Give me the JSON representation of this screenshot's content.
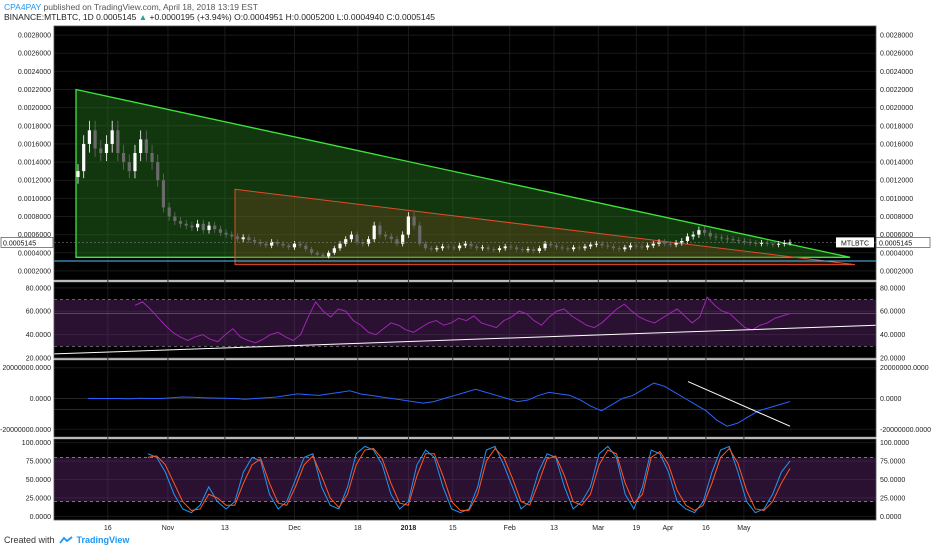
{
  "header": {
    "author": "CPA4PAY",
    "published_text": "published on TradingView.com, April 18, 2018 13:19 EST",
    "symbol": "BINANCE:MTLBTC, 1D",
    "last": "0.0005145",
    "change_arrow": "▲",
    "change": "+0.0000195 (+3.94%)",
    "open_label": "O:",
    "open": "0.0004951",
    "high_label": "H:",
    "high": "0.0005200",
    "low_label": "L:",
    "low": "0.0004940",
    "close_label": "C:",
    "close": "0.0005145"
  },
  "colors": {
    "background": "#000000",
    "grid": "#1a1a1a",
    "pane_border": "#555555",
    "axis_text": "#1e1e1e",
    "candle_up": "#ffffff",
    "candle_down": "#6a6a6a",
    "triangle_green": "#3ce63c",
    "triangle_fill": "rgba(40,120,30,0.45)",
    "triangle_red": "#e04b2a",
    "triangle_red_fill": "rgba(120,70,30,0.35)",
    "rsi": "#9c27b0",
    "rsi_band": "rgba(120,50,140,0.35)",
    "macd": "#2962ff",
    "stoch_k": "#2196f3",
    "stoch_d": "#ff5722",
    "trendline": "#ffffff",
    "cyan_line": "#4fc3f7"
  },
  "chart_data": [
    {
      "type": "candlestick",
      "pane": "price",
      "ylim": [
        0.0001,
        0.0029
      ],
      "yticks": [
        "0.0028000",
        "0.0026000",
        "0.0024000",
        "0.0022000",
        "0.0020000",
        "0.0018000",
        "0.0016000",
        "0.0014000",
        "0.0012000",
        "0.0010000",
        "0.0008000",
        "0.0006000",
        "0.0004000",
        "0.0002000"
      ],
      "ytick_values": [
        0.0028,
        0.0026,
        0.0024,
        0.0022,
        0.002,
        0.0018,
        0.0016,
        0.0014,
        0.0012,
        0.001,
        0.0008,
        0.0006,
        0.0004,
        0.0002
      ],
      "price_tag_left": "0.0005145",
      "price_tag_right": "0.0005145",
      "symbol_tag": "MTLBTC",
      "last_price": 0.0005145,
      "support_level": 0.00031,
      "green_triangle": {
        "top": 0.0022,
        "bottom": 0.00035
      },
      "red_triangle": {
        "top": 0.0011,
        "bottom": 0.00027
      },
      "closes": [
        0.0013,
        0.0016,
        0.00175,
        0.00155,
        0.0015,
        0.0016,
        0.00175,
        0.0015,
        0.0014,
        0.0013,
        0.0015,
        0.00165,
        0.0015,
        0.0014,
        0.0012,
        0.0009,
        0.0008,
        0.00075,
        0.00072,
        0.0007,
        0.00068,
        0.00072,
        0.00065,
        0.0007,
        0.00066,
        0.00062,
        0.0006,
        0.00058,
        0.00055,
        0.00057,
        0.00054,
        0.00052,
        0.0005,
        0.00048,
        0.00052,
        0.0005,
        0.00048,
        0.00046,
        0.0005,
        0.00048,
        0.00044,
        0.0004,
        0.00038,
        0.00036,
        0.0004,
        0.00045,
        0.0005,
        0.00055,
        0.0006,
        0.00052,
        0.0005,
        0.00055,
        0.0007,
        0.0006,
        0.00058,
        0.00055,
        0.0005,
        0.0006,
        0.0008,
        0.0007,
        0.0005,
        0.00045,
        0.00044,
        0.00045,
        0.00047,
        0.00046,
        0.00045,
        0.00048,
        0.0005,
        0.00047,
        0.00045,
        0.00046,
        0.00044,
        0.00043,
        0.00045,
        0.00047,
        0.00046,
        0.00044,
        0.00043,
        0.00044,
        0.00042,
        0.00045,
        0.0005,
        0.00048,
        0.00046,
        0.00045,
        0.00044,
        0.00046,
        0.00045,
        0.00047,
        0.00049,
        0.0005,
        0.00048,
        0.00047,
        0.00045,
        0.00044,
        0.00046,
        0.00048,
        0.00047,
        0.00046,
        0.00048,
        0.0005,
        0.00052,
        0.0005,
        0.00049,
        0.00051,
        0.00053,
        0.00058,
        0.0006,
        0.00065,
        0.00062,
        0.00058,
        0.00057,
        0.00056,
        0.00055,
        0.00054,
        0.00053,
        0.00052,
        0.00051,
        0.0005,
        0.00051,
        0.0005,
        0.00049,
        0.0005,
        0.00051,
        0.000515
      ]
    },
    {
      "type": "line",
      "pane": "rsi",
      "ylim": [
        20,
        85
      ],
      "yticks": [
        "80.0000",
        "60.0000",
        "40.0000",
        "20.0000"
      ],
      "ytick_values": [
        80,
        60,
        40,
        20
      ],
      "upper_band": 70,
      "lower_band": 30,
      "mid_line": 58,
      "values": [
        65,
        68,
        62,
        55,
        48,
        42,
        38,
        35,
        38,
        40,
        36,
        34,
        40,
        45,
        38,
        35,
        33,
        36,
        40,
        42,
        38,
        35,
        40,
        55,
        68,
        60,
        55,
        62,
        60,
        52,
        48,
        42,
        40,
        45,
        50,
        48,
        44,
        42,
        46,
        50,
        52,
        48,
        50,
        54,
        52,
        56,
        50,
        48,
        46,
        52,
        55,
        60,
        58,
        52,
        48,
        55,
        60,
        62,
        56,
        52,
        48,
        46,
        50,
        56,
        62,
        66,
        60,
        55,
        52,
        50,
        54,
        58,
        62,
        56,
        50,
        55,
        72,
        65,
        60,
        58,
        52,
        46,
        44,
        48,
        50,
        54,
        56,
        58
      ]
    },
    {
      "type": "line",
      "pane": "macd",
      "ylim": [
        -25000000,
        25000000
      ],
      "yticks": [
        "20000000.0000",
        "0.0000",
        "-20000000.0000"
      ],
      "ytick_values": [
        20000000,
        0,
        -20000000
      ],
      "values": [
        0,
        0,
        0,
        0,
        -200000,
        200000,
        0,
        0,
        500000,
        1000000,
        800000,
        500000,
        300000,
        200000,
        0,
        -500000,
        0,
        500000,
        1000000,
        2000000,
        3000000,
        2500000,
        2000000,
        3000000,
        4000000,
        5000000,
        3000000,
        2000000,
        1000000,
        0,
        -1000000,
        -2000000,
        -3000000,
        -2000000,
        0,
        2000000,
        4000000,
        6000000,
        4000000,
        2000000,
        0,
        -2000000,
        -1000000,
        2000000,
        4000000,
        3000000,
        2000000,
        -1000000,
        -5000000,
        -8000000,
        -4000000,
        0,
        2000000,
        6000000,
        10000000,
        8000000,
        4000000,
        0,
        -4000000,
        -8000000,
        -14000000,
        -18000000,
        -16000000,
        -12000000,
        -8000000,
        -6000000,
        -4000000,
        -2000000
      ]
    },
    {
      "type": "line",
      "pane": "stochastic",
      "ylim": [
        -5,
        105
      ],
      "yticks": [
        "100.0000",
        "75.0000",
        "50.0000",
        "25.0000",
        "0.0000"
      ],
      "ytick_values": [
        100,
        75,
        50,
        25,
        0
      ],
      "upper_band": 80,
      "lower_band": 20,
      "series": [
        {
          "values": [
            85,
            80,
            60,
            30,
            10,
            5,
            15,
            40,
            20,
            10,
            20,
            60,
            80,
            75,
            30,
            10,
            20,
            50,
            80,
            85,
            40,
            15,
            10,
            40,
            85,
            95,
            90,
            70,
            30,
            10,
            20,
            70,
            90,
            80,
            40,
            10,
            5,
            10,
            40,
            90,
            95,
            70,
            40,
            10,
            20,
            60,
            85,
            80,
            40,
            10,
            20,
            40,
            85,
            95,
            80,
            30,
            10,
            40,
            90,
            85,
            60,
            20,
            10,
            5,
            20,
            60,
            90,
            95,
            60,
            20,
            5,
            10,
            30,
            60,
            75
          ]
        },
        {
          "values": [
            80,
            82,
            70,
            45,
            20,
            8,
            10,
            30,
            25,
            15,
            15,
            45,
            70,
            78,
            45,
            18,
            15,
            40,
            70,
            82,
            55,
            25,
            12,
            30,
            70,
            90,
            92,
            78,
            45,
            18,
            15,
            55,
            85,
            85,
            55,
            20,
            8,
            8,
            30,
            75,
            92,
            80,
            52,
            20,
            15,
            45,
            78,
            82,
            55,
            20,
            15,
            30,
            70,
            90,
            85,
            45,
            18,
            30,
            80,
            88,
            70,
            35,
            15,
            8,
            15,
            45,
            80,
            92,
            72,
            35,
            10,
            8,
            20,
            45,
            65
          ]
        }
      ]
    }
  ],
  "x_axis": {
    "labels": [
      "16",
      "Nov",
      "13",
      "Dec",
      "18",
      "2018",
      "15",
      "Feb",
      "13",
      "Mar",
      "19",
      "Apr",
      "16",
      "May"
    ],
    "positions": [
      0.085,
      0.18,
      0.27,
      0.38,
      0.48,
      0.56,
      0.63,
      0.72,
      0.79,
      0.86,
      0.92,
      0.97,
      1.03,
      1.09
    ]
  },
  "footer": {
    "created_with": "Created with",
    "brand": "TradingView"
  }
}
